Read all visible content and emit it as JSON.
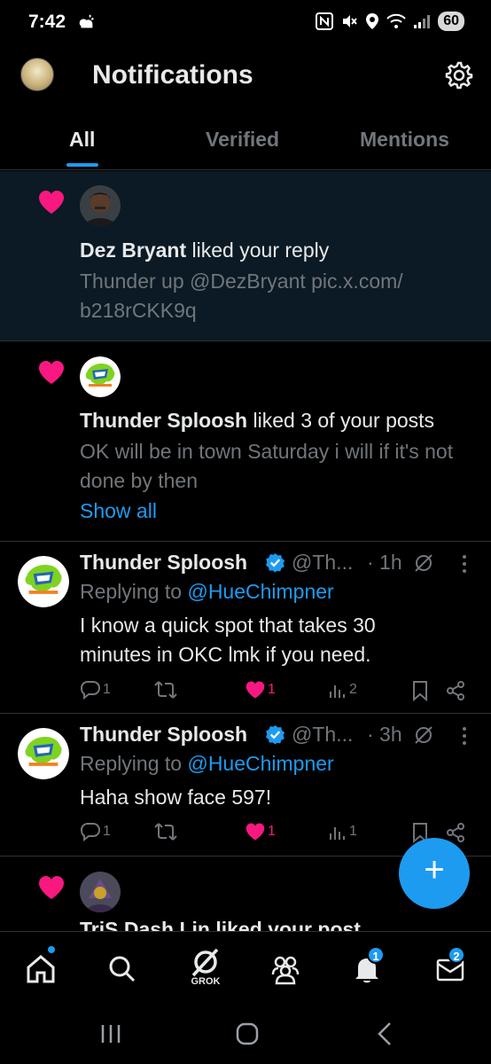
{
  "status_bar": {
    "time": "7:42",
    "battery": "60"
  },
  "header": {
    "title": "Notifications"
  },
  "tabs": [
    {
      "label": "All",
      "active": true
    },
    {
      "label": "Verified",
      "active": false
    },
    {
      "label": "Mentions",
      "active": false
    }
  ],
  "notifications": [
    {
      "type": "like",
      "user": "Dez Bryant",
      "action": " liked your reply",
      "snippet": "Thunder up @DezBryant pic.x.com/ b218rCKK9q"
    },
    {
      "type": "like",
      "user": "Thunder Sploosh",
      "action": " liked 3 of your posts",
      "snippet": "OK will be in town Saturday i will if it's not done by then",
      "show_all": "Show all"
    }
  ],
  "replies": [
    {
      "name": "Thunder Sploosh",
      "handle": "@Th...",
      "time": "· 1h",
      "replying_prefix": "Replying to ",
      "replying_to": "@HueChimpner",
      "body": "I know a quick spot that takes 30 minutes in OKC lmk if you need.",
      "reply_count": "1",
      "repost_count": "",
      "like_count": "1",
      "view_count": "2"
    },
    {
      "name": "Thunder Sploosh",
      "handle": "@Th...",
      "time": "· 3h",
      "replying_prefix": "Replying to ",
      "replying_to": "@HueChimpner",
      "body": "Haha show face 597!",
      "reply_count": "1",
      "repost_count": "",
      "like_count": "1",
      "view_count": "1"
    }
  ],
  "partial_notification": {
    "text": "TriS Dash Lin liked your post"
  },
  "bottom_nav": {
    "grok_label": "GROK",
    "notifications_badge": "1",
    "messages_badge": "2"
  },
  "colors": {
    "accent": "#1d9bf0",
    "like": "#f91880",
    "muted": "#71767b",
    "highlight_bg": "#0b1a24"
  }
}
